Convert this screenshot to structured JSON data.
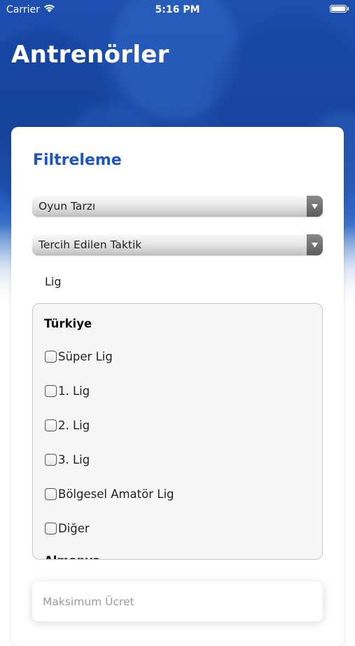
{
  "status_bar": {
    "carrier": "Carrier",
    "time": "5:16 PM"
  },
  "page": {
    "title": "Antrenörler"
  },
  "filter": {
    "title": "Filtreleme",
    "play_style": {
      "value": "Oyun Tarzı"
    },
    "preferred_tactic": {
      "value": "Tercih Edilen Taktik"
    },
    "league": {
      "label": "Lig",
      "groups": [
        {
          "title": "Türkiye",
          "options": [
            "Süper Lig",
            "1. Lig",
            "2. Lig",
            "3. Lig",
            "Bölgesel Amatör Lig",
            "Diğer"
          ]
        },
        {
          "title": "Almanya"
        }
      ]
    },
    "max_price": {
      "placeholder": "Maksimum Ücret",
      "value": ""
    }
  },
  "colors": {
    "header_blue": "#1d4fb0",
    "title_blue": "#1b56c2"
  }
}
